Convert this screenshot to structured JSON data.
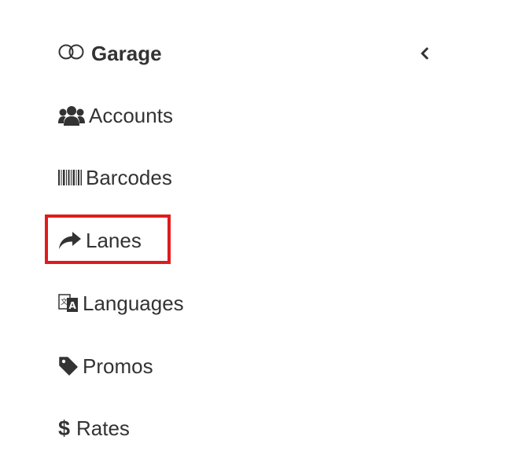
{
  "header": {
    "title": "Garage",
    "icon": "toggle-icon",
    "collapse_icon": "chevron-left-icon"
  },
  "items": [
    {
      "label": "Accounts",
      "icon": "users-icon"
    },
    {
      "label": "Barcodes",
      "icon": "barcode-icon"
    },
    {
      "label": "Lanes",
      "icon": "share-arrow-icon"
    },
    {
      "label": "Languages",
      "icon": "language-icon"
    },
    {
      "label": "Promos",
      "icon": "tag-icon"
    },
    {
      "label": "Rates",
      "icon": "dollar-icon"
    }
  ],
  "highlight": {
    "target": "Lanes",
    "color": "#e01b1b"
  },
  "colors": {
    "text": "#333333",
    "background": "#ffffff"
  }
}
